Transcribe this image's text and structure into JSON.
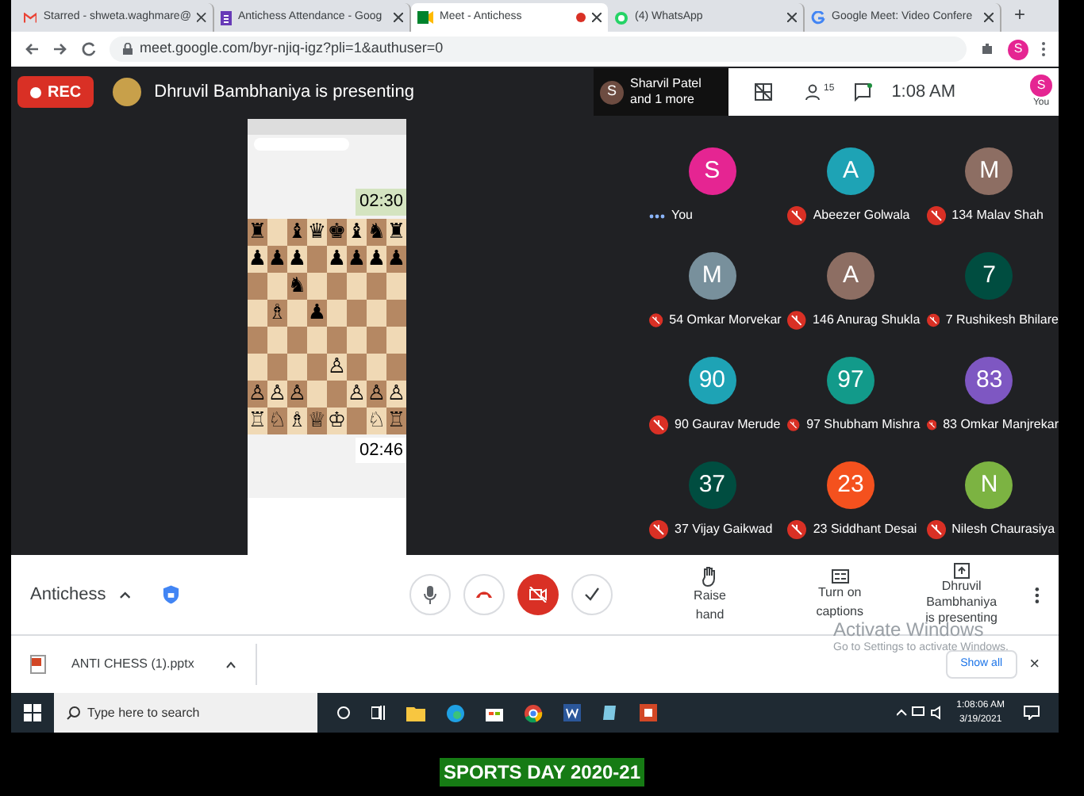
{
  "browser": {
    "tabs": [
      {
        "title": "Starred - shweta.waghmare@",
        "selected": false,
        "recording": false
      },
      {
        "title": "Antichess Attendance - Goog",
        "selected": false,
        "recording": false
      },
      {
        "title": "Meet - Antichess",
        "selected": true,
        "recording": true
      },
      {
        "title": "(4) WhatsApp",
        "selected": false,
        "recording": false
      },
      {
        "title": "Google Meet: Video Confere",
        "selected": false,
        "recording": false
      }
    ],
    "new_tab": "+",
    "url": "meet.google.com/byr-njiq-igz?pli=1&authuser=0",
    "profile_initial": "S"
  },
  "meet": {
    "rec_label": "REC",
    "presenter_banner": "Dhruvil Bambhaniya is presenting",
    "others": {
      "initial": "S",
      "text": [
        "Sharvil Patel",
        "and 1 more"
      ]
    },
    "people_count": "15",
    "time": "1:08 AM",
    "self_initial": "S",
    "self_label": "You",
    "shared_screen": {
      "top_clock": "02:30",
      "bottom_clock": "02:46",
      "board": [
        [
          {
            "kind": "piece",
            "piece": "♜"
          },
          {
            "kind": "empty"
          },
          {
            "kind": "piece",
            "piece": "♝"
          },
          {
            "kind": "piece",
            "piece": "♛"
          },
          {
            "kind": "piece",
            "piece": "♚"
          },
          {
            "kind": "piece",
            "piece": "♝"
          },
          {
            "kind": "piece",
            "piece": "♞"
          },
          {
            "kind": "piece",
            "piece": "♜"
          }
        ],
        [
          {
            "kind": "piece",
            "piece": "♟"
          },
          {
            "kind": "piece",
            "piece": "♟"
          },
          {
            "kind": "piece",
            "piece": "♟"
          },
          {
            "kind": "empty"
          },
          {
            "kind": "piece",
            "piece": "♟"
          },
          {
            "kind": "piece",
            "piece": "♟"
          },
          {
            "kind": "piece",
            "piece": "♟"
          },
          {
            "kind": "piece",
            "piece": "♟"
          }
        ],
        [
          {
            "kind": "empty"
          },
          {
            "kind": "empty"
          },
          {
            "kind": "piece",
            "piece": "♞"
          },
          {
            "kind": "empty"
          },
          {
            "kind": "empty"
          },
          {
            "kind": "empty"
          },
          {
            "kind": "empty"
          },
          {
            "kind": "empty"
          }
        ],
        [
          {
            "kind": "empty"
          },
          {
            "kind": "piece",
            "piece": "♗"
          },
          {
            "kind": "empty"
          },
          {
            "kind": "piece",
            "piece": "♟"
          },
          {
            "kind": "empty"
          },
          {
            "kind": "empty"
          },
          {
            "kind": "empty"
          },
          {
            "kind": "empty"
          }
        ],
        [
          {
            "kind": "empty"
          },
          {
            "kind": "empty"
          },
          {
            "kind": "empty"
          },
          {
            "kind": "empty"
          },
          {
            "kind": "empty"
          },
          {
            "kind": "empty"
          },
          {
            "kind": "empty"
          },
          {
            "kind": "empty"
          }
        ],
        [
          {
            "kind": "empty"
          },
          {
            "kind": "empty"
          },
          {
            "kind": "empty"
          },
          {
            "kind": "empty"
          },
          {
            "kind": "piece",
            "piece": "♙"
          },
          {
            "kind": "empty"
          },
          {
            "kind": "empty"
          },
          {
            "kind": "empty"
          }
        ],
        [
          {
            "kind": "piece",
            "piece": "♙"
          },
          {
            "kind": "piece",
            "piece": "♙"
          },
          {
            "kind": "piece",
            "piece": "♙"
          },
          {
            "kind": "empty"
          },
          {
            "kind": "empty"
          },
          {
            "kind": "piece",
            "piece": "♙"
          },
          {
            "kind": "piece",
            "piece": "♙"
          },
          {
            "kind": "piece",
            "piece": "♙"
          }
        ],
        [
          {
            "kind": "piece",
            "piece": "♖"
          },
          {
            "kind": "piece",
            "piece": "♘"
          },
          {
            "kind": "piece",
            "piece": "♗"
          },
          {
            "kind": "piece",
            "piece": "♕"
          },
          {
            "kind": "piece",
            "piece": "♔"
          },
          {
            "kind": "empty"
          },
          {
            "kind": "piece",
            "piece": "♘"
          },
          {
            "kind": "piece",
            "piece": "♖"
          }
        ]
      ]
    },
    "participants": [
      {
        "initial": "S",
        "color": "#e52592",
        "name": "You",
        "muted": false
      },
      {
        "initial": "A",
        "color": "#1ea3b5",
        "name": "Abeezer Golwala",
        "muted": true
      },
      {
        "initial": "M",
        "color": "#8d6e63",
        "name": "134 Malav Shah",
        "muted": true
      },
      {
        "initial": "M",
        "color": "#78909c",
        "name": "54 Omkar Morvekar",
        "muted": true
      },
      {
        "initial": "A",
        "color": "#8d6e63",
        "name": "146 Anurag Shukla",
        "muted": true
      },
      {
        "initial": "7",
        "color": "#004d40",
        "name": "7 Rushikesh Bhilare",
        "muted": true
      },
      {
        "initial": "90",
        "color": "#1ea3b5",
        "name": "90 Gaurav Merude",
        "muted": true
      },
      {
        "initial": "97",
        "color": "#129a8a",
        "name": "97 Shubham Mishra",
        "muted": true
      },
      {
        "initial": "83",
        "color": "#7e57c2",
        "name": "83 Omkar Manjrekar",
        "muted": true
      },
      {
        "initial": "37",
        "color": "#004d40",
        "name": "37 Vijay Gaikwad",
        "muted": true
      },
      {
        "initial": "23",
        "color": "#f4511e",
        "name": "23 Siddhant Desai",
        "muted": true
      },
      {
        "initial": "N",
        "color": "#7cb342",
        "name": "Nilesh Chaurasiya",
        "muted": true
      }
    ],
    "bottom": {
      "meeting_name": "Antichess",
      "raise_hand": "Raise hand",
      "captions": "Turn on captions",
      "presenting": [
        "Dhruvil Bambhaniya",
        "is presenting"
      ]
    }
  },
  "downloads": {
    "file": "ANTI CHESS (1).pptx",
    "show_all": "Show all",
    "close": "×"
  },
  "activation": {
    "title": "Activate Windows",
    "text": "Go to Settings to activate Windows."
  },
  "taskbar": {
    "search_placeholder": "Type here to search",
    "time": "1:08:06 AM",
    "date": "3/19/2021"
  },
  "caption": "SPORTS DAY 2020-21"
}
